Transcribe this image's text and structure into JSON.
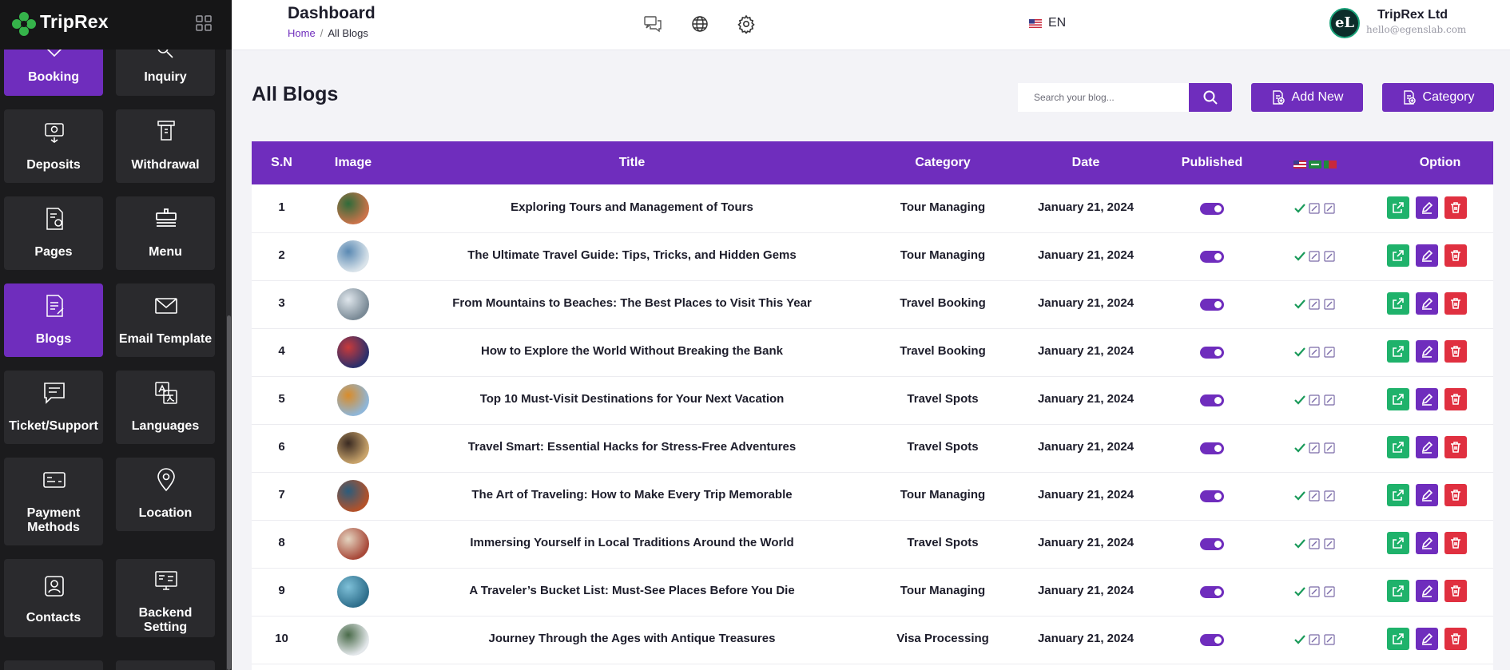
{
  "brand": {
    "name": "TripRex",
    "accent": "#6f2dbd"
  },
  "sidebar": {
    "items": [
      {
        "label": "Booking",
        "icon": "booking-icon",
        "active": true
      },
      {
        "label": "Inquiry",
        "icon": "inquiry-icon",
        "active": false
      },
      {
        "label": "Deposits",
        "icon": "deposits-icon",
        "active": false
      },
      {
        "label": "Withdrawal",
        "icon": "withdrawal-icon",
        "active": false
      },
      {
        "label": "Pages",
        "icon": "pages-icon",
        "active": false
      },
      {
        "label": "Menu",
        "icon": "menu-icon",
        "active": false
      },
      {
        "label": "Blogs",
        "icon": "blogs-icon",
        "active": true
      },
      {
        "label": "Email Template",
        "icon": "email-icon",
        "active": false
      },
      {
        "label": "Ticket/Support",
        "icon": "ticket-support-icon",
        "active": false
      },
      {
        "label": "Languages",
        "icon": "languages-icon",
        "active": false
      },
      {
        "label": "Payment Methods",
        "icon": "payment-methods-icon",
        "active": false
      },
      {
        "label": "Location",
        "icon": "location-icon",
        "active": false
      },
      {
        "label": "Contacts",
        "icon": "contacts-icon",
        "active": false
      },
      {
        "label": "Backend Setting",
        "icon": "backend-setting-icon",
        "active": false
      }
    ]
  },
  "header": {
    "title": "Dashboard",
    "breadcrumb": {
      "home": "Home",
      "separator": "/",
      "current": "All Blogs"
    },
    "language": "EN",
    "user": {
      "name": "TripRex Ltd",
      "email": "hello@egenslab.com",
      "avatar_text": "eL"
    }
  },
  "toolbar": {
    "heading": "All Blogs",
    "search_placeholder": "Search your blog...",
    "add_new_label": "Add New",
    "category_label": "Category"
  },
  "table": {
    "columns": [
      "S.N",
      "Image",
      "Title",
      "Category",
      "Date",
      "Published",
      "",
      "Option"
    ],
    "rows": [
      {
        "sn": "1",
        "title": "Exploring Tours and Management of Tours",
        "category": "Tour Managing",
        "date": "January 21, 2024",
        "published": true
      },
      {
        "sn": "2",
        "title": "The Ultimate Travel Guide: Tips, Tricks, and Hidden Gems",
        "category": "Tour Managing",
        "date": "January 21, 2024",
        "published": true
      },
      {
        "sn": "3",
        "title": "From Mountains to Beaches: The Best Places to Visit This Year",
        "category": "Travel Booking",
        "date": "January 21, 2024",
        "published": true
      },
      {
        "sn": "4",
        "title": "How to Explore the World Without Breaking the Bank",
        "category": "Travel Booking",
        "date": "January 21, 2024",
        "published": true
      },
      {
        "sn": "5",
        "title": "Top 10 Must-Visit Destinations for Your Next Vacation",
        "category": "Travel Spots",
        "date": "January 21, 2024",
        "published": true
      },
      {
        "sn": "6",
        "title": "Travel Smart: Essential Hacks for Stress-Free Adventures",
        "category": "Travel Spots",
        "date": "January 21, 2024",
        "published": true
      },
      {
        "sn": "7",
        "title": "The Art of Traveling: How to Make Every Trip Memorable",
        "category": "Tour Managing",
        "date": "January 21, 2024",
        "published": true
      },
      {
        "sn": "8",
        "title": "Immersing Yourself in Local Traditions Around the World",
        "category": "Travel Spots",
        "date": "January 21, 2024",
        "published": true
      },
      {
        "sn": "9",
        "title": "A Traveler’s Bucket List: Must-See Places Before You Die",
        "category": "Tour Managing",
        "date": "January 21, 2024",
        "published": true
      },
      {
        "sn": "10",
        "title": "Journey Through the Ages with Antique Treasures",
        "category": "Visa Processing",
        "date": "January 21, 2024",
        "published": true
      }
    ]
  }
}
